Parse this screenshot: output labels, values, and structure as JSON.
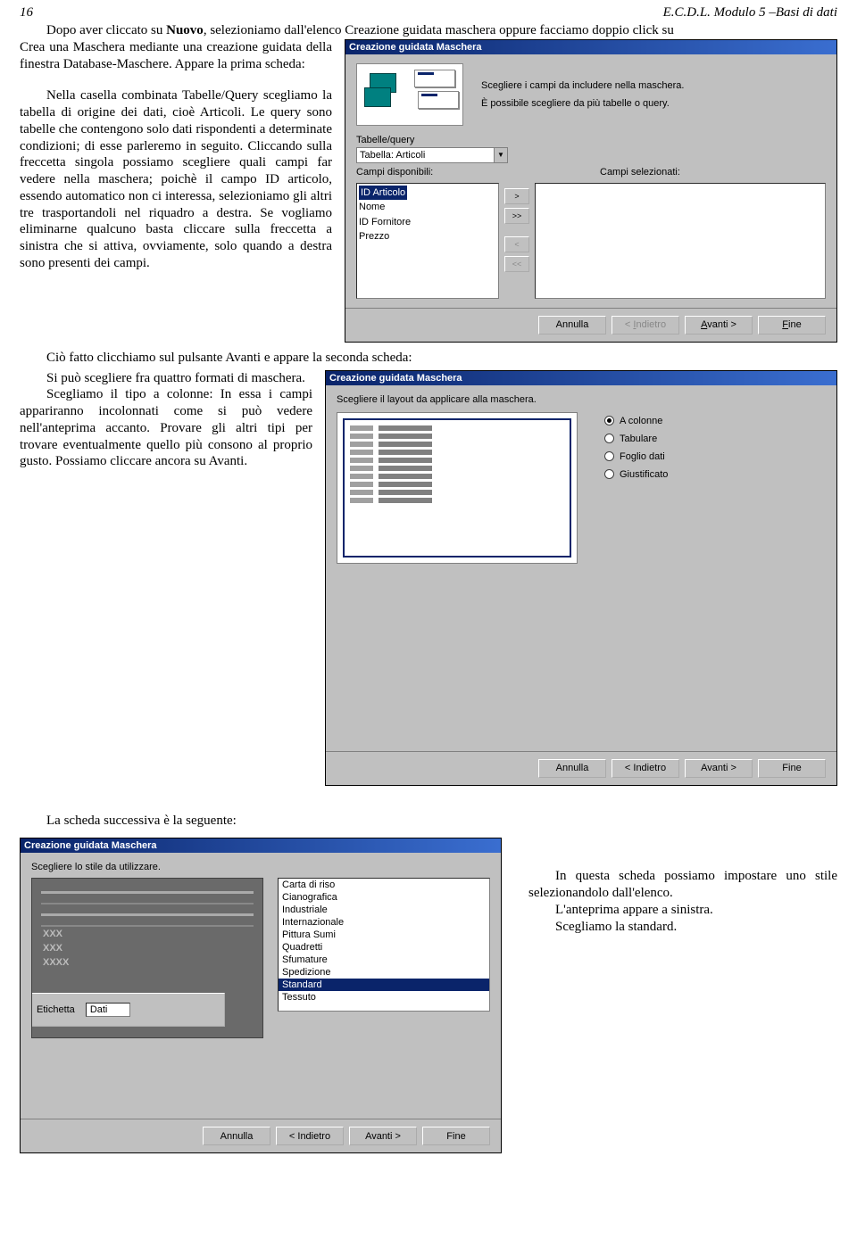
{
  "header": {
    "page_num": "16",
    "doc_title": "E.C.D.L. Modulo 5 –Basi di dati"
  },
  "p1a": "Dopo aver cliccato su ",
  "p1b": "Nuovo",
  "p1c": ", selezioniamo dall'elenco Creazione guidata maschera oppure facciamo doppio click su",
  "p2": "Crea una Maschera mediante una creazione guidata della finestra Database-Maschere. Appare la prima scheda:",
  "p3": "Nella casella combinata Tabelle/Query scegliamo la tabella di origine dei dati, cioè Articoli. Le query sono tabelle che contengono solo dati rispondenti a determinate condizioni; di esse parleremo in seguito. Cliccando sulla freccetta singola possiamo scegliere quali campi far vedere nella maschera; poichè il campo ID articolo, essendo automatico non ci interessa, selezioniamo gli altri tre trasportandoli nel riquadro a destra. Se vogliamo eliminarne qualcuno basta cliccare sulla freccetta a sinistra che si attiva, ovviamente, solo quando a destra sono presenti dei campi.",
  "p4": "Ciò fatto clicchiamo sul pulsante Avanti e appare la seconda scheda:",
  "p5": "Si può scegliere fra quattro formati di maschera.",
  "p6": "Scegliamo il tipo a colonne: In essa i campi appariranno incolonnati come si può vedere nell'anteprima accanto. Provare gli altri tipi per trovare eventualmente quello più consono al proprio gusto. Possiamo cliccare ancora su Avanti.",
  "p7": "La scheda successiva è la seguente:",
  "p8": "In questa scheda possiamo impostare uno stile selezionandolo dall'elenco.",
  "p9": "L'anteprima appare a sinistra.",
  "p10": "Scegliamo la standard.",
  "wiz1": {
    "title": "Creazione guidata Maschera",
    "line1": "Scegliere i campi da includere nella maschera.",
    "line2": "È possibile scegliere da più tabelle o query.",
    "lbl_tq": "Tabelle/query",
    "combo_val": "Tabella: Articoli",
    "lbl_disp": "Campi disponibili:",
    "lbl_sel": "Campi selezionati:",
    "fields": {
      "f0": "ID Articolo",
      "f1": "Nome",
      "f2": "ID Fornitore",
      "f3": "Prezzo"
    },
    "btns": {
      "cancel": "Annulla",
      "back": "< Indietro",
      "next": "Avanti >",
      "finish": "Fine"
    },
    "underlines": {
      "back": "I",
      "next": "A",
      "finish": "F"
    }
  },
  "wiz2": {
    "title": "Creazione guidata Maschera",
    "prompt": "Scegliere il layout da applicare alla maschera.",
    "opts": {
      "o0": "A colonne",
      "o1": "Tabulare",
      "o2": "Foglio dati",
      "o3": "Giustificato"
    },
    "btns": {
      "cancel": "Annulla",
      "back": "< Indietro",
      "next": "Avanti >",
      "finish": "Fine"
    }
  },
  "wiz3": {
    "title": "Creazione guidata Maschera",
    "prompt": "Scegliere lo stile da utilizzare.",
    "etichetta": "Etichetta",
    "dati": "Dati",
    "xxx1": "XXX",
    "xxx2": "XXX",
    "xxx3": "XXXX",
    "styles": {
      "s0": "Carta di riso",
      "s1": "Cianografica",
      "s2": "Industriale",
      "s3": "Internazionale",
      "s4": "Pittura Sumi",
      "s5": "Quadretti",
      "s6": "Sfumature",
      "s7": "Spedizione",
      "s8": "Standard",
      "s9": "Tessuto"
    },
    "btns": {
      "cancel": "Annulla",
      "back": "< Indietro",
      "next": "Avanti >",
      "finish": "Fine"
    }
  }
}
